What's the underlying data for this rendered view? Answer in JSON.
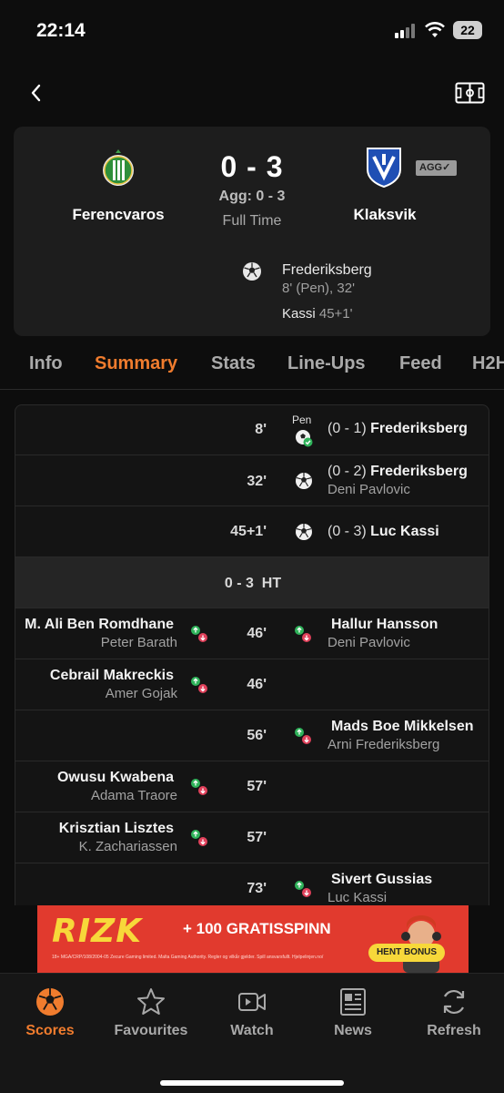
{
  "status_bar": {
    "time": "22:14",
    "battery": "22"
  },
  "match": {
    "home_team": "Ferencvaros",
    "away_team": "Klaksvik",
    "score": "0 - 3",
    "aggregate": "Agg: 0 - 3",
    "status": "Full Time",
    "agg_badge": "AGG",
    "scorers": [
      {
        "name": "Frederiksberg",
        "minutes": "8' (Pen), 32'"
      },
      {
        "name": "Kassi",
        "minutes": "45+1'"
      }
    ]
  },
  "tabs": [
    "Info",
    "Summary",
    "Stats",
    "Line-Ups",
    "Feed",
    "H2H"
  ],
  "active_tab": "Summary",
  "events": [
    {
      "minute": "8'",
      "label": "Pen",
      "score": "(0 - 1)",
      "player": "Frederiksberg",
      "assist": ""
    },
    {
      "minute": "32'",
      "score": "(0 - 2)",
      "player": "Frederiksberg",
      "assist": "Deni Pavlovic"
    },
    {
      "minute": "45+1'",
      "score": "(0 - 3)",
      "player": "Luc Kassi",
      "assist": ""
    },
    {
      "ht_score": "0 - 3",
      "ht_label": "HT"
    },
    {
      "minute": "46'",
      "home_in": "M. Ali Ben Romdhane",
      "home_out": "Peter Barath",
      "away_in": "Hallur Hansson",
      "away_out": "Deni Pavlovic"
    },
    {
      "minute": "46'",
      "home_in": "Cebrail Makreckis",
      "home_out": "Amer Gojak"
    },
    {
      "minute": "56'",
      "away_in": "Mads Boe Mikkelsen",
      "away_out": "Arni Frederiksberg"
    },
    {
      "minute": "57'",
      "home_in": "Owusu Kwabena",
      "home_out": "Adama Traore"
    },
    {
      "minute": "57'",
      "home_in": "Krisztian Lisztes",
      "home_out": "K. Zachariassen"
    },
    {
      "minute": "73'",
      "away_in": "Sivert Gussias",
      "away_out": "Luc Kassi"
    }
  ],
  "ad": {
    "logo": "RIZK",
    "offer": "+ 100 GRATISSPINN",
    "cta": "HENT BONUS",
    "fine_print": "18+ MGA/CRP/108/2004-05 Zecure Gaming limited. Malta Gaming Authority. Regler og vilkår gjelder. Spill ansvarsfullt. Hjelpelinjen.no/",
    "brand_color": "#e13a2e",
    "logo_color": "#f7d83a"
  },
  "nav": [
    {
      "label": "Scores",
      "icon": "soccer-ball-icon"
    },
    {
      "label": "Favourites",
      "icon": "star-icon"
    },
    {
      "label": "Watch",
      "icon": "video-icon"
    },
    {
      "label": "News",
      "icon": "newspaper-icon"
    },
    {
      "label": "Refresh",
      "icon": "refresh-icon"
    }
  ],
  "colors": {
    "accent": "#f07c2e",
    "background": "#0d0d0d",
    "card": "#1d1d1d"
  }
}
